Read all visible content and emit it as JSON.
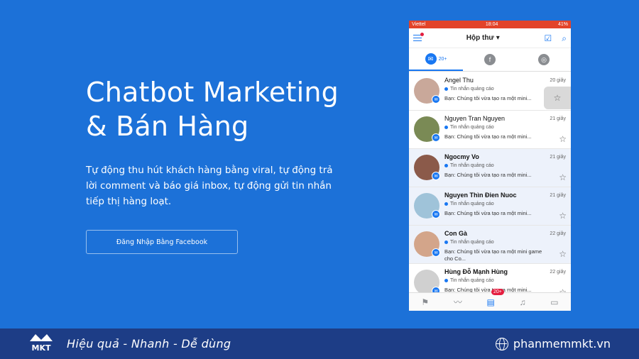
{
  "hero": {
    "title_line1": "Chatbot Marketing",
    "title_line2": "& Bán Hàng",
    "description": "Tự động thu hút khách hàng bằng viral, tự động trả lời comment và báo giá inbox, tự động gửi tin nhắn tiếp thị hàng loạt.",
    "login_label": "Đăng Nhập Bằng Facebook"
  },
  "phone": {
    "status": {
      "carrier": "Viettel",
      "time": "18:04",
      "battery": "41%"
    },
    "header_title": "Hộp thư",
    "tabs": [
      {
        "icon": "messenger-icon",
        "badge": "20+"
      },
      {
        "icon": "facebook-icon"
      },
      {
        "icon": "instagram-icon"
      }
    ],
    "conversations": [
      {
        "name": "Angel Thu",
        "time": "20 giây",
        "tag": "Tin nhắn quảng cáo",
        "preview": "Bạn: Chúng tôi vừa tạo ra một mini...",
        "bold": false,
        "highlight": false,
        "avatar_color": "#c9a89a"
      },
      {
        "name": "Nguyen Tran Nguyen",
        "time": "21 giây",
        "tag": "Tin nhắn quảng cáo",
        "preview": "Bạn: Chúng tôi vừa tạo ra một mini...",
        "bold": false,
        "highlight": false,
        "avatar_color": "#7a8a55"
      },
      {
        "name": "Ngocmy Vo",
        "time": "21 giây",
        "tag": "Tin nhắn quảng cáo",
        "preview": "Bạn: Chúng tôi vừa tạo ra một mini...",
        "bold": true,
        "highlight": true,
        "avatar_color": "#8b5a4a"
      },
      {
        "name": "Nguyen Thìn Đien Nuoc",
        "time": "21 giây",
        "tag": "Tin nhắn quảng cáo",
        "preview": "Bạn: Chúng tôi vừa tạo ra một mini...",
        "bold": true,
        "highlight": true,
        "avatar_color": "#9fc3d9"
      },
      {
        "name": "Con Gà",
        "time": "22 giây",
        "tag": "Tin nhắn quảng cáo",
        "preview": "Bạn: Chúng tôi vừa tạo ra một mini game cho Co...",
        "bold": true,
        "highlight": true,
        "avatar_color": "#d3a58a"
      },
      {
        "name": "Hùng Đỗ Mạnh Hùng",
        "time": "22 giây",
        "tag": "Tin nhắn quảng cáo",
        "preview": "Bạn: Chúng tôi vừa tạo ra một mini...",
        "bold": true,
        "highlight": false,
        "avatar_color": "#d0d0d0"
      }
    ],
    "bottom_badge": "20+"
  },
  "footer": {
    "slogan": "Hiệu quả - Nhanh - Dễ dùng",
    "website": "phanmemmkt.vn",
    "logo_text": "MKT"
  }
}
